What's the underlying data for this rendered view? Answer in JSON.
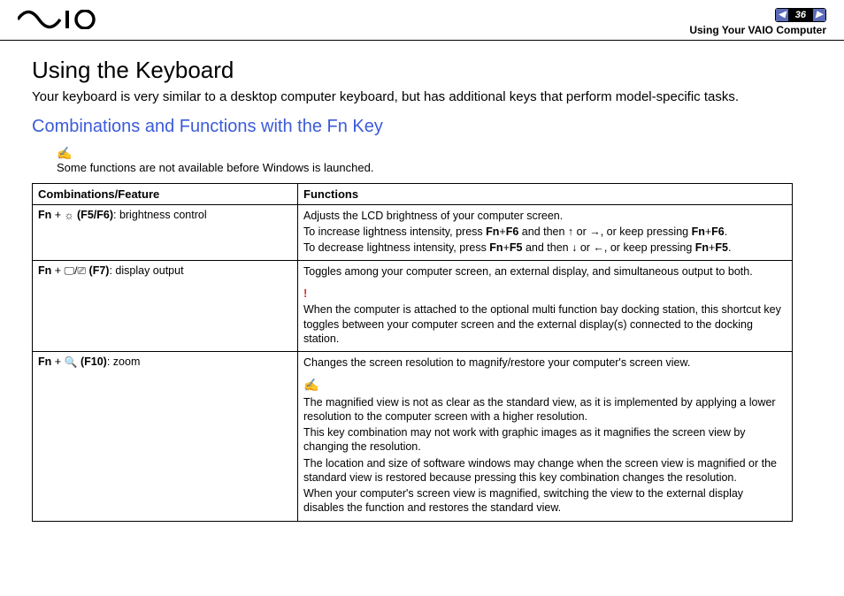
{
  "header": {
    "page_number": "36",
    "breadcrumb": "Using Your VAIO Computer"
  },
  "main": {
    "title": "Using the Keyboard",
    "intro": "Your keyboard is very similar to a desktop computer keyboard, but has additional keys that perform model-specific tasks.",
    "subheading": "Combinations and Functions with the Fn Key",
    "note": "Some functions are not available before Windows is launched."
  },
  "table": {
    "col1_header": "Combinations/Feature",
    "col2_header": "Functions",
    "rows": [
      {
        "combo_prefix": "Fn",
        "combo_plus": " + ",
        "combo_key": "(F5/F6)",
        "combo_suffix": ": brightness control",
        "func_lines": [
          "Adjusts the LCD brightness of your computer screen.",
          "To increase lightness intensity, press Fn+F6 and then ↑ or →, or keep pressing Fn+F6.",
          "To decrease lightness intensity, press Fn+F5 and then ↓ or ←, or keep pressing Fn+F5."
        ]
      },
      {
        "combo_prefix": "Fn",
        "combo_plus": " + ",
        "combo_key": "(F7)",
        "combo_suffix": ": display output",
        "func_intro": "Toggles among your computer screen, an external display, and simultaneous output to both.",
        "func_warn": "When the computer is attached to the optional multi function bay docking station, this shortcut key toggles between your computer screen and the external display(s) connected to the docking station."
      },
      {
        "combo_prefix": "Fn",
        "combo_plus": " + ",
        "combo_key": "(F10)",
        "combo_suffix": ": zoom",
        "func_intro": "Changes the screen resolution to magnify/restore your computer's screen view.",
        "func_note_lines": [
          "The magnified view is not as clear as the standard view, as it is implemented by applying a lower resolution to the computer screen with a higher resolution.",
          "This key combination may not work with graphic images as it magnifies the screen view by changing the resolution.",
          "The location and size of software windows may change when the screen view is magnified or the standard view is restored because pressing this key combination changes the resolution.",
          "When your computer's screen view is magnified, switching the view to the external display disables the function and restores the standard view."
        ]
      }
    ]
  },
  "icons": {
    "brightness": "☼",
    "display1": "🖵",
    "display2": "⎚",
    "zoom": "🔍",
    "up": "↑",
    "right": "→",
    "down": "↓",
    "left": "←"
  }
}
